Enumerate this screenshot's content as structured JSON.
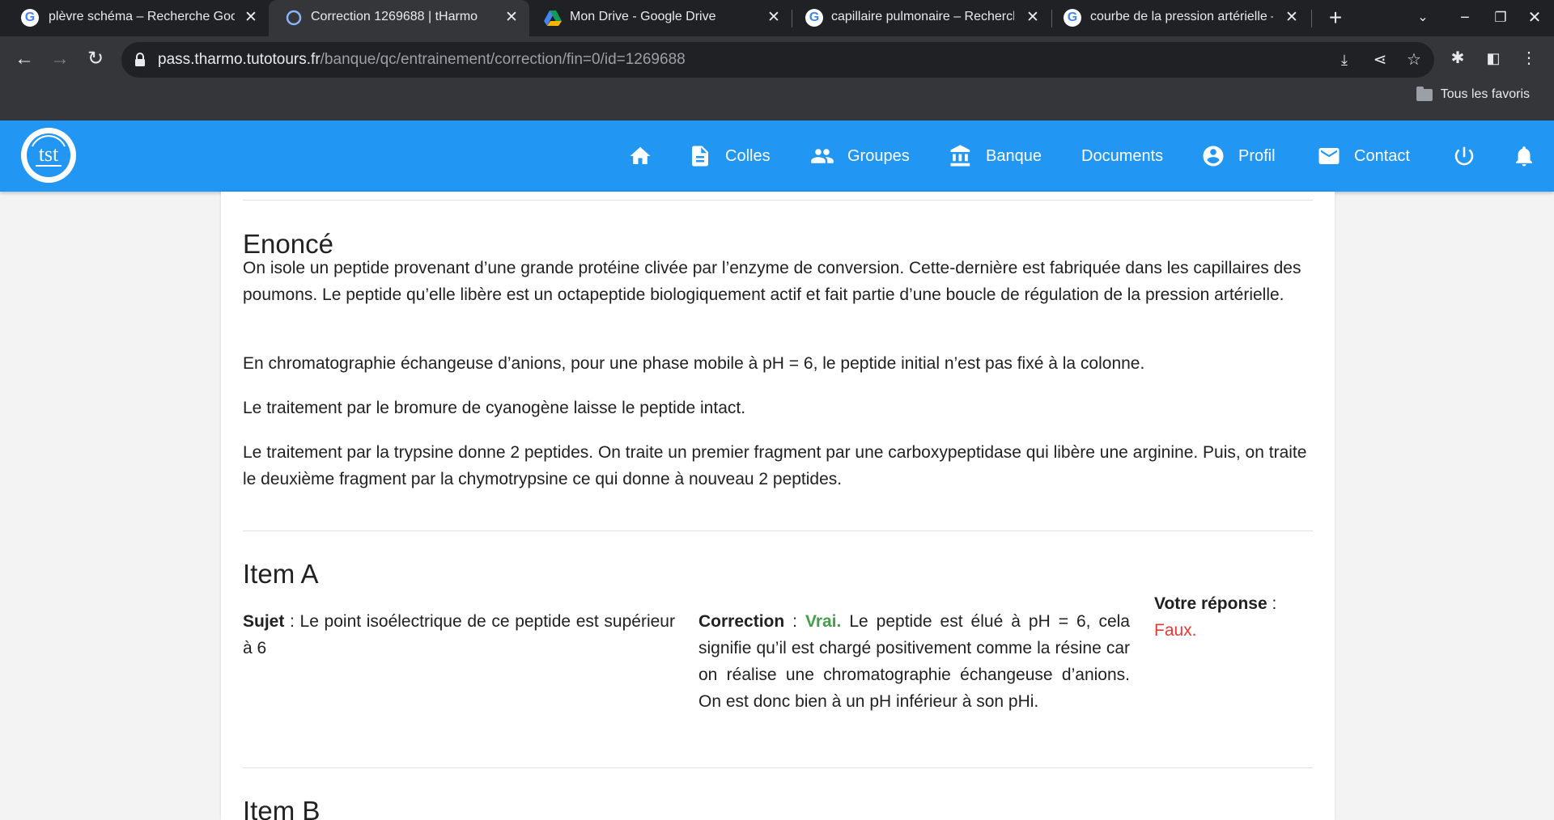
{
  "browser": {
    "tabs": [
      {
        "title": "plèvre schéma – Recherche Google",
        "favicon": "google-favicon",
        "active": false
      },
      {
        "title": "Correction 1269688 | tHarmo",
        "favicon": "tharmo-favicon",
        "active": true
      },
      {
        "title": "Mon Drive - Google Drive",
        "favicon": "google-drive-favicon",
        "active": false
      },
      {
        "title": "capillaire pulmonaire – Recherche Google",
        "favicon": "google-favicon",
        "active": false
      },
      {
        "title": "courbe de la pression artérielle – Recherche Google",
        "favicon": "google-favicon",
        "active": false
      }
    ],
    "url_host": "pass.tharmo.tutotours.fr",
    "url_path": "/banque/qc/entrainement/correction/fin=0/id=1269688",
    "bookmarks_label": "Tous les favoris"
  },
  "navbar": {
    "brand_color": "#2196f3",
    "logo_icon": "tutotours-logo",
    "items": [
      {
        "label": "",
        "icon": "home-icon"
      },
      {
        "label": "Colles",
        "icon": "document-icon"
      },
      {
        "label": "Groupes",
        "icon": "people-icon"
      },
      {
        "label": "Banque",
        "icon": "bank-icon"
      },
      {
        "label": "Documents",
        "icon": ""
      },
      {
        "label": "Profil",
        "icon": "account-circle-icon"
      },
      {
        "label": "Contact",
        "icon": "mail-icon"
      },
      {
        "label": "",
        "icon": "power-icon"
      },
      {
        "label": "",
        "icon": "bell-icon"
      }
    ]
  },
  "enonce": {
    "heading": "Enoncé",
    "paragraphs": [
      "On isole un peptide provenant d’une grande protéine clivée par l’enzyme de conversion. Cette-dernière est fabriquée dans les capillaires des poumons. Le peptide qu’elle libère est un octapeptide biologiquement actif et fait partie d’une boucle de régulation de la pression artérielle.",
      "En chromatographie échangeuse d’anions, pour une phase mobile à pH = 6, le peptide initial n’est pas fixé à la colonne.",
      "Le traitement par le bromure de cyanogène laisse le peptide intact.",
      "Le traitement par la trypsine donne 2 peptides. On traite un premier fragment par une carboxypeptidase qui libère une arginine. Puis, on traite le deuxième fragment par la chymotrypsine ce qui donne à nouveau 2 peptides."
    ]
  },
  "item_a": {
    "heading": "Item A",
    "sujet_label": "Sujet",
    "sujet_text": "Le point isoélectrique de ce peptide est supérieur à 6",
    "correction_label": "Correction",
    "correction_verdict": "Vrai.",
    "correction_text": "Le peptide est élué à pH = 6, cela signifie qu’il est chargé positivement comme la résine car on réalise une chromatographie échangeuse d’anions. On est donc bien à un pH inférieur à son pHi.",
    "reponse_label": "Votre réponse",
    "reponse_value": "Faux.",
    "verdict_color": "#43a047",
    "wrong_color": "#e53935"
  },
  "item_b": {
    "heading": "Item B"
  }
}
